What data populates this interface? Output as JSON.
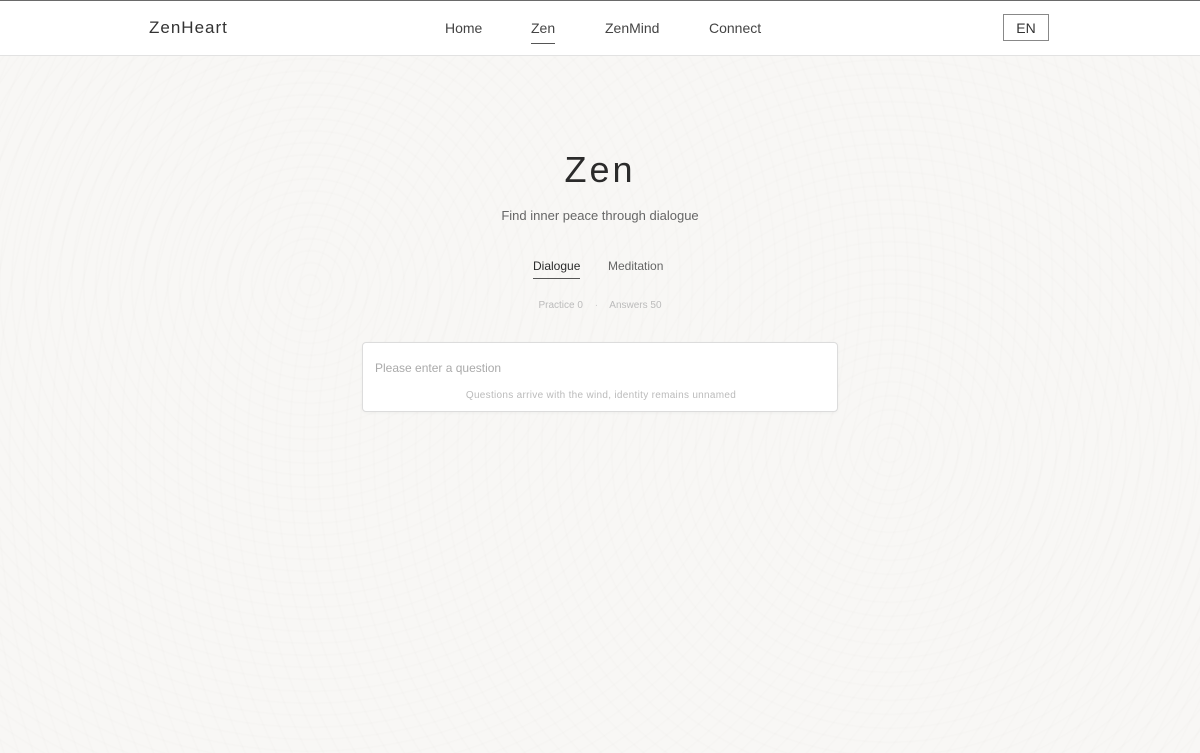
{
  "header": {
    "brand": "ZenHeart",
    "nav": [
      {
        "label": "Home"
      },
      {
        "label": "Zen"
      },
      {
        "label": "ZenMind"
      },
      {
        "label": "Connect"
      }
    ],
    "active_nav": "Zen",
    "language": "EN"
  },
  "main": {
    "title": "Zen",
    "subtitle": "Find inner peace through dialogue",
    "tabs": [
      {
        "label": "Dialogue"
      },
      {
        "label": "Meditation"
      }
    ],
    "active_tab": "Dialogue",
    "stats": {
      "practice_label": "Practice",
      "practice_value": "0",
      "separator": "·",
      "answers_label": "Answers",
      "answers_value": "50"
    },
    "question": {
      "value": "",
      "placeholder": "Please enter a question",
      "hint": "Questions arrive with the wind, identity remains unnamed"
    }
  }
}
